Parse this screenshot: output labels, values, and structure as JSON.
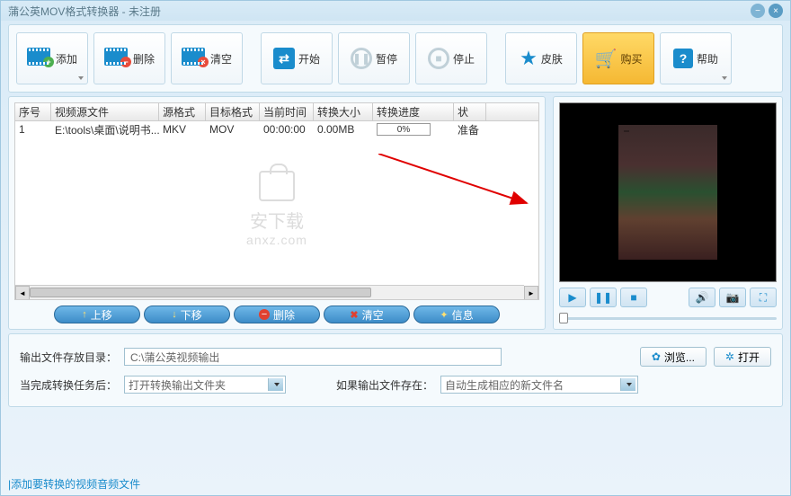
{
  "window": {
    "title": "蒲公英MOV格式转换器 - 未注册"
  },
  "toolbar": {
    "add": "添加",
    "delete": "删除",
    "clear": "清空",
    "start": "开始",
    "pause": "暂停",
    "stop": "停止",
    "skin": "皮肤",
    "buy": "购买",
    "help": "帮助"
  },
  "table": {
    "headers": {
      "index": "序号",
      "source": "视频源文件",
      "srcfmt": "源格式",
      "dstfmt": "目标格式",
      "curtime": "当前时间",
      "size": "转换大小",
      "progress": "转换进度",
      "status": "状"
    },
    "rows": [
      {
        "index": "1",
        "source": "E:\\tools\\桌面\\说明书...",
        "srcfmt": "MKV",
        "dstfmt": "MOV",
        "curtime": "00:00:00",
        "size": "0.00MB",
        "progress": "0%",
        "status": "准备"
      }
    ]
  },
  "list_actions": {
    "moveup": "上移",
    "movedown": "下移",
    "delete": "删除",
    "clear": "清空",
    "info": "信息"
  },
  "watermark": {
    "line1": "安下载",
    "line2": "anxz.com"
  },
  "output": {
    "dir_label": "输出文件存放目录：",
    "dir_value": "C:\\蒲公英视频输出",
    "browse": "浏览...",
    "open": "打开",
    "after_label": "当完成转换任务后：",
    "after_value": "打开转换输出文件夹",
    "exists_label": "如果输出文件存在：",
    "exists_value": "自动生成相应的新文件名"
  },
  "status": "添加要转换的视频音频文件"
}
